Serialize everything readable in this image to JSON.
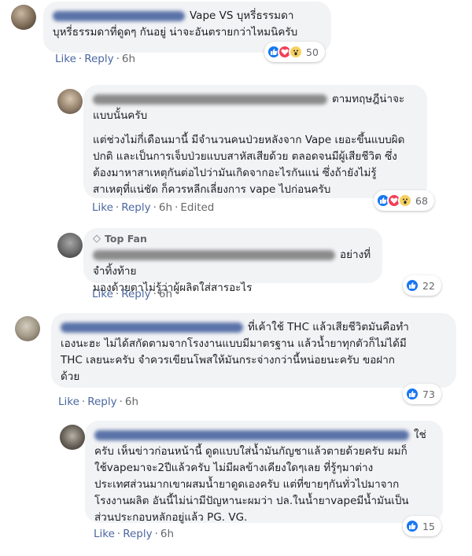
{
  "comments": [
    {
      "text": "Vape VS บุหรี่ธรรมดา\nบุหรี่ธรรมดาที่ดูดๆ กันอยู่ น่าจะอันตรายกว่าไหมนิครับ",
      "actions": {
        "like": "Like",
        "reply": "Reply",
        "time": "6h"
      },
      "reaction_count": "50",
      "reaction_icons": [
        "like-icon",
        "love-icon",
        "wow-icon"
      ]
    },
    {
      "text_1": "ตามทฤษฎีน่าจะ\nแบบนั้นครับ",
      "text_2": "แต่ช่วงไม่กี่เดือนมานี้ มีจำนวนคนป่วยหลังจาก Vape เยอะขึ้นแบบผิด\nปกติ และเป็นการเจ็บป่วยแบบสาหัสเสียด้วย ตลอดจนมีผู้เสียชีวิต ซึ่ง\nต้องมาหาสาเหตุกันต่อไปว่ามันเกิดจากอะไรกันแน่ ซึ่งถ้ายังไม่รู้\nสาเหตุที่แน่ชัด ก็ควรหลีกเลี่ยงการ vape ไปก่อนครับ",
      "actions": {
        "like": "Like",
        "reply": "Reply",
        "time": "6h",
        "edited": "Edited"
      },
      "reaction_count": "68",
      "reaction_icons": [
        "like-icon",
        "love-icon",
        "wow-icon"
      ]
    },
    {
      "badge": "Top Fan",
      "text": "อย่างที่จำทิ้งท้าย\nมองด้วยตาไม่รู้ว่าผู้ผลิตใส่สารอะไร",
      "actions": {
        "like": "Like",
        "reply": "Reply",
        "time": "6h"
      },
      "reaction_count": "22",
      "reaction_icons": [
        "like-icon"
      ]
    },
    {
      "text": "ที่เค้าใช้ THC แล้วเสียชีวิตมันคือทำ\nเองนะฮะ ไม่ได้สกัดตามจากโรงงานแบบมีมาตรฐาน แล้วน้ำยาทุกตัวก็ไม่ได้มี\nTHC เลยนะครับ จำควรเขียนโพสให้มันกระจ่างกว่านี้หน่อยนะครับ ขอฝาก\nด้วย",
      "actions": {
        "like": "Like",
        "reply": "Reply",
        "time": "6h"
      },
      "reaction_count": "73",
      "reaction_icons": [
        "like-icon"
      ]
    },
    {
      "text": "ใช่\nครับ เห็นข่าวก่อนหน้านี้ ดูดแบบใส่น้ำมันกัญชาแล้วตายด้วยครับ ผมก็\nใช้vapeมาจะ2ปีแล้วครับ ไม่มีผลข้างเคียงใดๆเลย ที่รู้ๆมาต่าง\nประเทศส่วนมากเขาผสมน้ำยาดูดเองครับ แต่ที่ขายๆกันทั่วไปมาจาก\nโรงงานผลิต อันนี้ไม่น่ามีปัญหานะผมว่า ปล.ในน้ำยาvapeมีน้ำมันเป็น\nส่วนประกอบหลักอยู่แล้ว PG. VG.",
      "actions": {
        "like": "Like",
        "reply": "Reply",
        "time": "6h"
      },
      "reaction_count": "15",
      "reaction_icons": [
        "like-icon"
      ]
    }
  ]
}
